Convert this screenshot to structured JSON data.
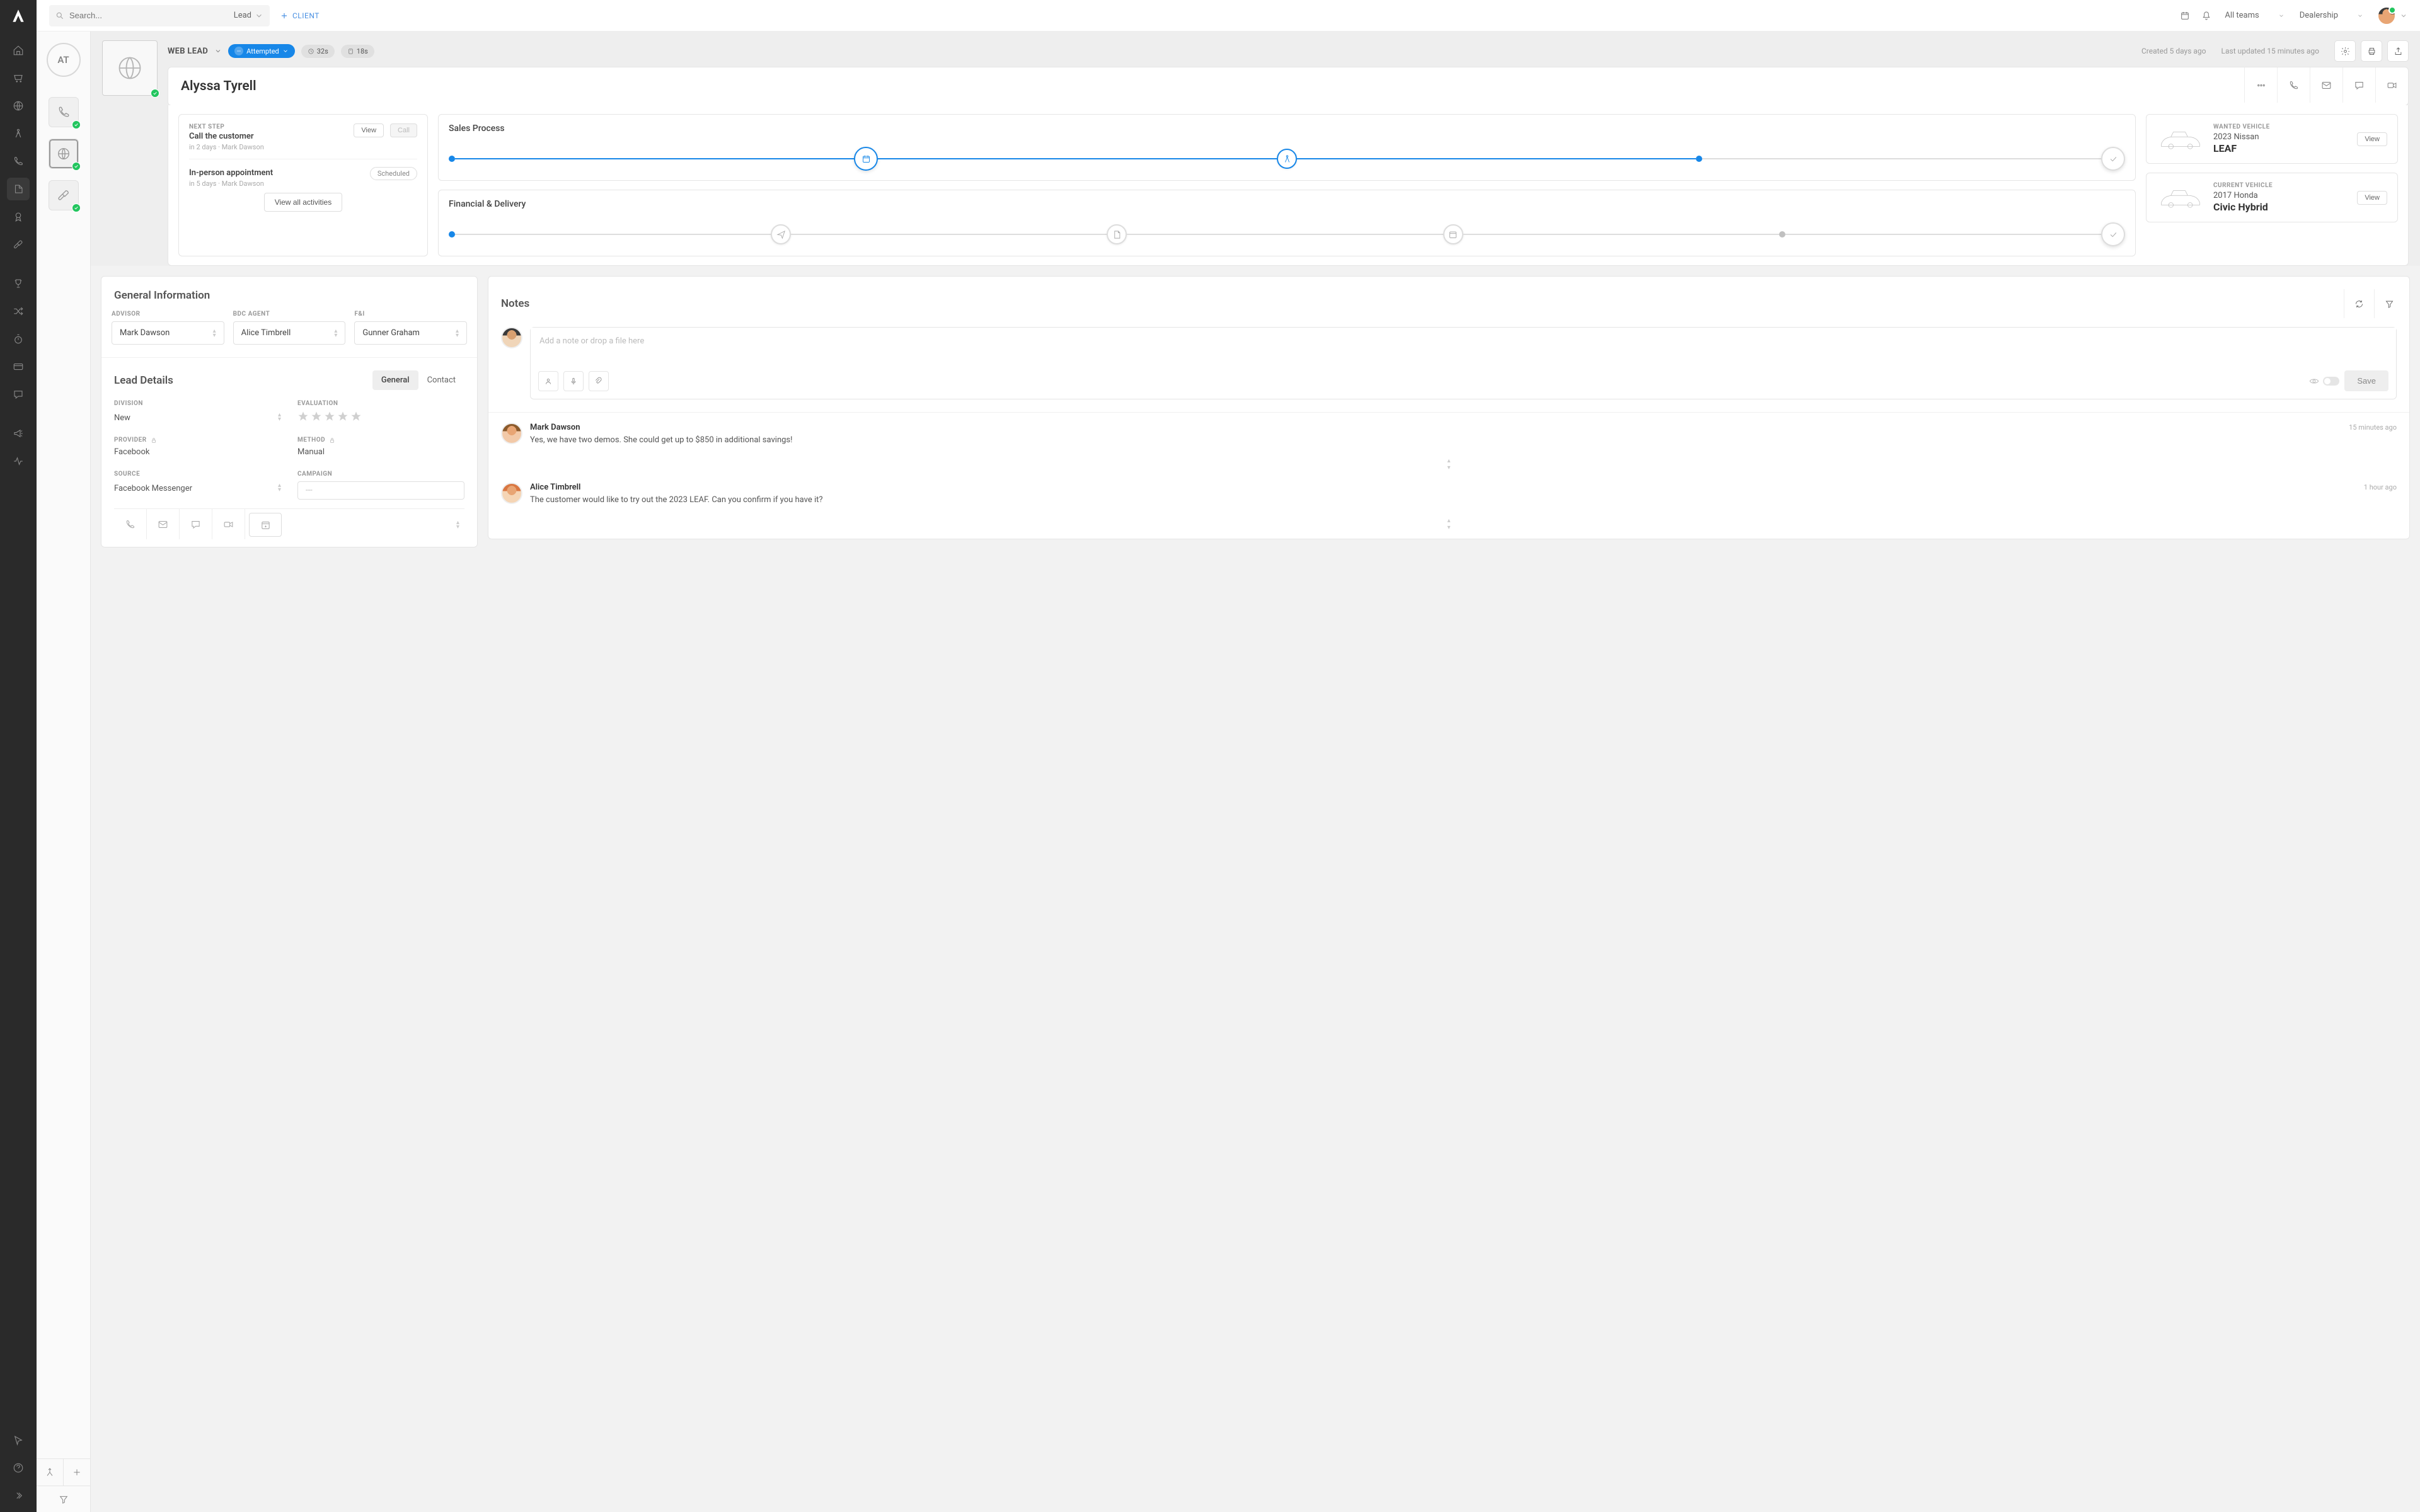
{
  "topbar": {
    "search_placeholder": "Search...",
    "search_type": "Lead",
    "add_client": "CLIENT",
    "team": "All teams",
    "dealership": "Dealership"
  },
  "secondary": {
    "initials": "AT"
  },
  "header": {
    "lead_type": "WEB LEAD",
    "status": "Attempted",
    "timer1": "32s",
    "timer2": "18s",
    "created": "Created 5 days ago",
    "updated": "Last updated 15 minutes ago",
    "name": "Alyssa Tyrell"
  },
  "activities": {
    "next_step_label": "NEXT STEP",
    "item1": {
      "title": "Call the customer",
      "sub": "in 2 days · Mark Dawson"
    },
    "item2": {
      "title": "In-person appointment",
      "sub": "in 5 days · Mark Dawson"
    },
    "view": "View",
    "call": "Call",
    "scheduled": "Scheduled",
    "view_all": "View all activities"
  },
  "process": {
    "sales_title": "Sales Process",
    "financial_title": "Financial & Delivery"
  },
  "vehicles": {
    "wanted_label": "WANTED VEHICLE",
    "wanted_year": "2023 Nissan",
    "wanted_model": "LEAF",
    "current_label": "CURRENT VEHICLE",
    "current_year": "2017 Honda",
    "current_model": "Civic Hybrid",
    "view": "View"
  },
  "general": {
    "title": "General Information",
    "advisor_label": "ADVISOR",
    "advisor": "Mark Dawson",
    "bdc_label": "BDC AGENT",
    "bdc": "Alice Timbrell",
    "fi_label": "F&I",
    "fi": "Gunner Graham"
  },
  "lead_details": {
    "title": "Lead Details",
    "tab_general": "General",
    "tab_contact": "Contact",
    "division_label": "DIVISION",
    "division": "New",
    "evaluation_label": "EVALUATION",
    "provider_label": "PROVIDER",
    "provider": "Facebook",
    "method_label": "METHOD",
    "method": "Manual",
    "source_label": "SOURCE",
    "source": "Facebook Messenger",
    "campaign_label": "CAMPAIGN",
    "campaign": "---"
  },
  "notes": {
    "title": "Notes",
    "placeholder": "Add a note or drop a file here",
    "save": "Save",
    "entries": [
      {
        "author": "Mark Dawson",
        "time": "15 minutes ago",
        "text": "Yes, we have two demos. She could get up to $850 in additional savings!"
      },
      {
        "author": "Alice Timbrell",
        "time": "1 hour ago",
        "text": "The customer would like to try out the 2023 LEAF. Can you confirm if you have it?"
      }
    ]
  }
}
